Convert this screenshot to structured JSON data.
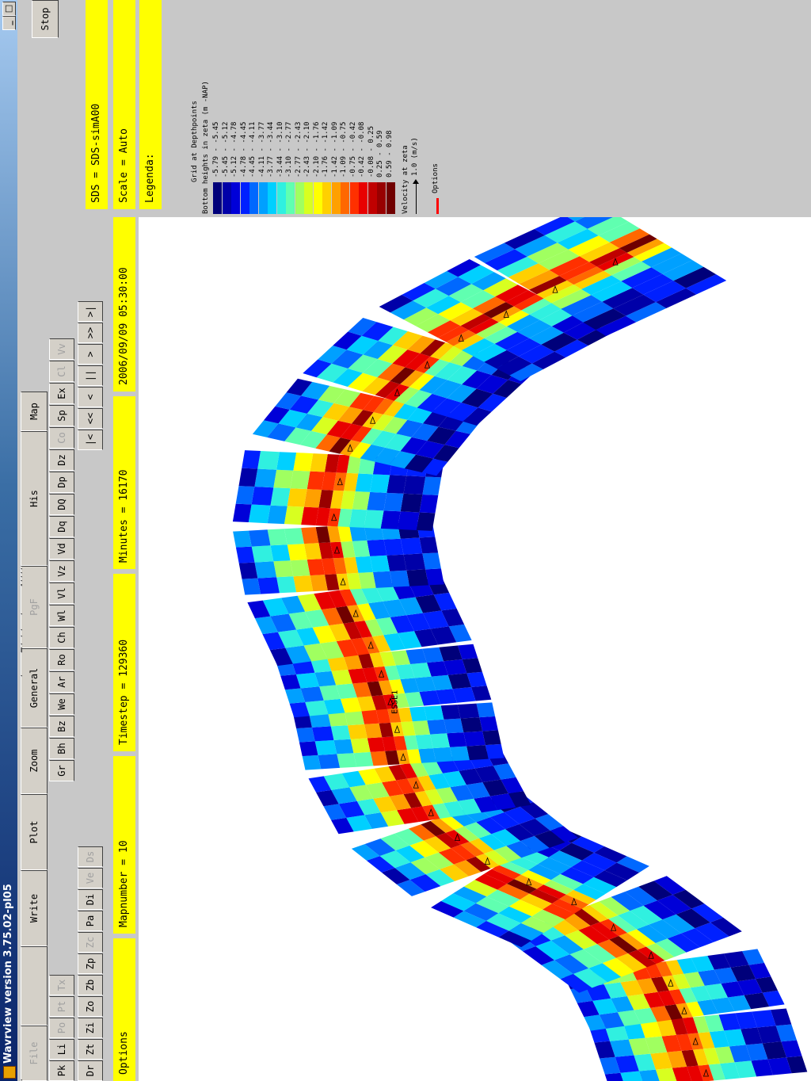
{
  "window": {
    "title": "Wavrview version 3.75.02-pl05",
    "minimize_glyph": "_",
    "maximize_glyph": "□"
  },
  "menu": {
    "file": "File",
    "write": "Write",
    "plot": "Plot",
    "zoom": "Zoom",
    "general": "General",
    "pgf": "PgF",
    "his": "His",
    "map": "Map",
    "stop": "Stop"
  },
  "toolbar": {
    "row1": [
      {
        "label": "Pk",
        "enabled": true
      },
      {
        "label": "Li",
        "enabled": true
      },
      {
        "label": "Po",
        "enabled": false
      },
      {
        "label": "Pt",
        "enabled": false
      },
      {
        "label": "Tx",
        "enabled": false
      }
    ],
    "row2_left": [
      {
        "label": "Dr",
        "enabled": true
      },
      {
        "label": "Zt",
        "enabled": true
      },
      {
        "label": "Zi",
        "enabled": true
      },
      {
        "label": "Zo",
        "enabled": true
      },
      {
        "label": "Zb",
        "enabled": true
      },
      {
        "label": "Zp",
        "enabled": true
      },
      {
        "label": "Zc",
        "enabled": false
      },
      {
        "label": "Pa",
        "enabled": true
      },
      {
        "label": "Di",
        "enabled": true
      },
      {
        "label": "Ve",
        "enabled": false
      },
      {
        "label": "Ds",
        "enabled": false
      }
    ],
    "row2_right": [
      {
        "label": "Gr",
        "enabled": true
      },
      {
        "label": "Bh",
        "enabled": true
      },
      {
        "label": "Bz",
        "enabled": true
      },
      {
        "label": "We",
        "enabled": true
      },
      {
        "label": "Ar",
        "enabled": true
      },
      {
        "label": "Ro",
        "enabled": true
      },
      {
        "label": "Ch",
        "enabled": true
      },
      {
        "label": "Wl",
        "enabled": true
      },
      {
        "label": "Vl",
        "enabled": true
      },
      {
        "label": "Vz",
        "enabled": true
      },
      {
        "label": "Vd",
        "enabled": true
      },
      {
        "label": "Dq",
        "enabled": true
      },
      {
        "label": "DQ",
        "enabled": true
      },
      {
        "label": "Dp",
        "enabled": true
      },
      {
        "label": "Dz",
        "enabled": true
      },
      {
        "label": "Co",
        "enabled": false
      },
      {
        "label": "Sp",
        "enabled": true
      },
      {
        "label": "Ex",
        "enabled": true
      },
      {
        "label": "Cl",
        "enabled": false
      },
      {
        "label": "Vv",
        "enabled": false
      }
    ],
    "nav": [
      "|<",
      "<<",
      "<",
      "||",
      ">",
      ">>",
      ">|"
    ]
  },
  "status": {
    "options": "Options",
    "mapnumber": "Mapnumber =   10",
    "timestep": "Timestep =   129360",
    "minutes": "Minutes =    16170",
    "datetime": "2006/09/09   05:30:00",
    "sds": "SDS   =    SDS-simA00",
    "scale": "Scale =    Auto",
    "legenda": "Legenda:"
  },
  "legend": {
    "title": "Grid at Depthpoints",
    "subtitle": "Bottom heights in zeta (m -NAP)",
    "entries": [
      {
        "label": "-5.79 - -5.45",
        "color": "#00007a"
      },
      {
        "label": "-5.45 - -5.12",
        "color": "#0000a8"
      },
      {
        "label": "-5.12 - -4.78",
        "color": "#0000d8"
      },
      {
        "label": "-4.78 - -4.45",
        "color": "#0020ff"
      },
      {
        "label": "-4.45 - -4.11",
        "color": "#0068ff"
      },
      {
        "label": "-4.11 - -3.77",
        "color": "#00a0ff"
      },
      {
        "label": "-3.77 - -3.44",
        "color": "#00d0ff"
      },
      {
        "label": "-3.44 - -3.10",
        "color": "#30f0e0"
      },
      {
        "label": "-3.10 - -2.77",
        "color": "#60ffb0"
      },
      {
        "label": "-2.77 - -2.43",
        "color": "#a0ff60"
      },
      {
        "label": "-2.43 - -2.10",
        "color": "#d8ff20"
      },
      {
        "label": "-2.10 - -1.76",
        "color": "#ffff00"
      },
      {
        "label": "-1.76 - -1.42",
        "color": "#ffd000"
      },
      {
        "label": "-1.42 - -1.09",
        "color": "#ffa000"
      },
      {
        "label": "-1.09 - -0.75",
        "color": "#ff6800"
      },
      {
        "label": "-0.75 - -0.42",
        "color": "#ff3000"
      },
      {
        "label": "-0.42 - -0.08",
        "color": "#e80000"
      },
      {
        "label": "-0.08 - 0.25",
        "color": "#c00000"
      },
      {
        "label": "0.25 - 0.59",
        "color": "#980000"
      },
      {
        "label": "0.59 - 0.98",
        "color": "#700000"
      }
    ],
    "velocity_title": "Velocity at zeta",
    "velocity_scale": "1.0 (m/s)",
    "options_label": "Options",
    "options_color": "#ff0000"
  },
  "map": {
    "station_label": "ESSE1"
  }
}
